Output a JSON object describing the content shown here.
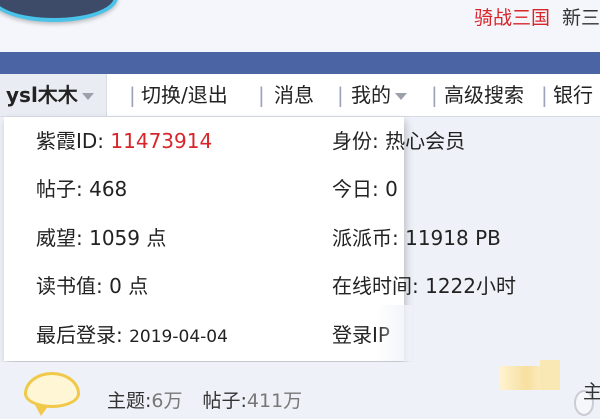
{
  "header": {
    "link_game": "骑战三国",
    "link_new": "新三"
  },
  "nav": {
    "username": "ysl木木",
    "switch_logout": "切换/退出",
    "messages": "消息",
    "mine": "我的",
    "advanced_search": "高级搜索",
    "bank": "银行",
    "separator": "|"
  },
  "profile": {
    "id_label": "紫霞ID:",
    "id_value": "11473914",
    "identity_label": "身份:",
    "identity_value": "热心会员",
    "posts_label": "帖子:",
    "posts_value": "468",
    "today_label": "今日:",
    "today_value": "0",
    "prestige_label": "威望:",
    "prestige_value": "1059 点",
    "paipai_label": "派派币:",
    "paipai_value": "11918 PB",
    "reading_label": "读书值:",
    "reading_value": "0 点",
    "online_label": "在线时间:",
    "online_value": "1222小时",
    "last_login_label": "最后登录:",
    "last_login_value": "2019-04-04",
    "login_ip_label": "登录IP"
  },
  "forum": {
    "topics_label": "主题:",
    "topics_value": "6万",
    "posts_label": "帖子:",
    "posts_value": "411万",
    "right_cut": "主"
  },
  "colors": {
    "accent_red": "#d7262a",
    "nav_blue": "#4a64a4"
  },
  "icons": {
    "logo": "site-logo",
    "caret": "chevron-down-icon",
    "forum": "speech-bubble-icon"
  }
}
